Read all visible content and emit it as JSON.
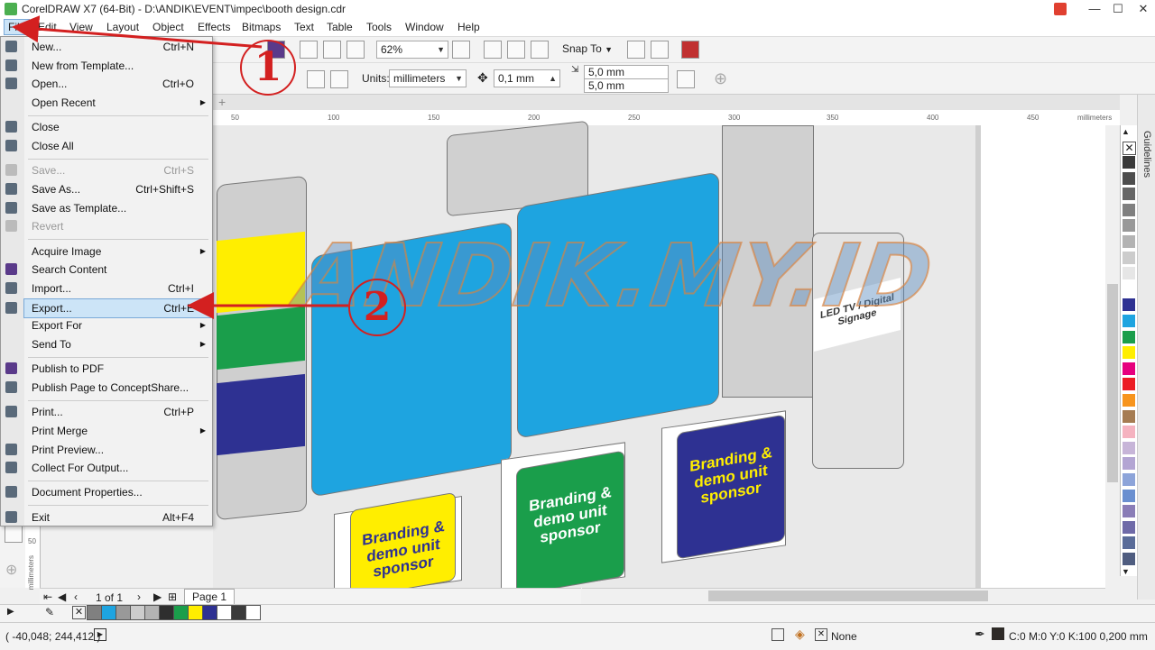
{
  "window": {
    "title": "CorelDRAW X7 (64-Bit) - D:\\ANDIK\\EVENT\\impec\\booth design.cdr",
    "min_icon": "minimize-icon",
    "max_icon": "maximize-icon",
    "close_glyph": "✕",
    "min_glyph": "—",
    "max_glyph": "☐"
  },
  "menubar": [
    "File",
    "Edit",
    "View",
    "Layout",
    "Object",
    "Effects",
    "Bitmaps",
    "Text",
    "Table",
    "Tools",
    "Window",
    "Help"
  ],
  "toolbar": {
    "zoom": "62%",
    "snap_to": "Snap To",
    "units_label": "Units:",
    "units_value": "millimeters",
    "nudge": "0,1 mm",
    "dup_x": "5,0 mm",
    "dup_y": "5,0 mm"
  },
  "ruler": {
    "ticks": [
      "50",
      "100",
      "150",
      "200",
      "250",
      "300",
      "350",
      "400",
      "450"
    ],
    "unit": "millimeters",
    "v_tick": "50",
    "v_unit": "millimeters"
  },
  "file_menu": [
    {
      "label": "New...",
      "shortcut": "Ctrl+N",
      "icon": "new-doc-icon"
    },
    {
      "label": "New from Template...",
      "shortcut": "",
      "icon": "template-icon"
    },
    {
      "label": "Open...",
      "shortcut": "Ctrl+O",
      "icon": "open-folder-icon"
    },
    {
      "label": "Open Recent",
      "shortcut": "",
      "submenu": true
    },
    {
      "label": "Close",
      "shortcut": "",
      "icon": "close-doc-icon"
    },
    {
      "label": "Close All",
      "shortcut": "",
      "icon": "close-all-icon"
    },
    {
      "label": "Save...",
      "shortcut": "Ctrl+S",
      "disabled": true,
      "icon": "save-icon"
    },
    {
      "label": "Save As...",
      "shortcut": "Ctrl+Shift+S",
      "icon": "save-as-icon"
    },
    {
      "label": "Save as Template...",
      "shortcut": "",
      "icon": "save-template-icon"
    },
    {
      "label": "Revert",
      "shortcut": "",
      "disabled": true,
      "icon": "revert-icon"
    },
    {
      "label": "Acquire Image",
      "shortcut": "",
      "submenu": true
    },
    {
      "label": "Search Content",
      "shortcut": "",
      "icon": "search-content-icon"
    },
    {
      "label": "Import...",
      "shortcut": "Ctrl+I",
      "icon": "import-icon"
    },
    {
      "label": "Export...",
      "shortcut": "Ctrl+E",
      "icon": "export-icon",
      "highlight": true
    },
    {
      "label": "Export For",
      "shortcut": "",
      "submenu": true
    },
    {
      "label": "Send To",
      "shortcut": "",
      "submenu": true
    },
    {
      "label": "Publish to PDF",
      "shortcut": "",
      "icon": "pdf-icon"
    },
    {
      "label": "Publish Page to ConceptShare...",
      "shortcut": "",
      "icon": "conceptshare-icon"
    },
    {
      "label": "Print...",
      "shortcut": "Ctrl+P",
      "icon": "print-icon"
    },
    {
      "label": "Print Merge",
      "shortcut": "",
      "submenu": true
    },
    {
      "label": "Print Preview...",
      "shortcut": "",
      "icon": "print-preview-icon"
    },
    {
      "label": "Collect For Output...",
      "shortcut": "",
      "icon": "collect-icon"
    },
    {
      "label": "Document Properties...",
      "shortcut": "",
      "icon": "doc-properties-icon"
    },
    {
      "label": "Exit",
      "shortcut": "Alt+F4",
      "icon": "exit-icon"
    }
  ],
  "canvas": {
    "sponsor_text": "Branding & demo unit sponsor",
    "led_text": "LED TV / Digital Signage",
    "watermark": "ANDIK.MY.ID"
  },
  "annotations": {
    "step1": "1",
    "step2": "2"
  },
  "page_nav": {
    "count": "1 of 1",
    "tab": "Page 1"
  },
  "status": {
    "coords": "( -40,048; 244,412 )",
    "fill": "None",
    "outline": "C:0 M:0 Y:0 K:100  0,200 mm"
  },
  "colors": {
    "cyan": "#1ea4e0",
    "yellow": "#ffee00",
    "green": "#1a9e4b",
    "navy": "#2e3192",
    "gray": "#cfcfcf",
    "annotation_red": "#d32020",
    "menu_highlight": "#cce4f7",
    "palette": [
      "#3a3a3a",
      "#4d4d4d",
      "#666666",
      "#808080",
      "#999999",
      "#b3b3b3",
      "#cccccc",
      "#e6e6e6",
      "#ffffff",
      "#2e3192",
      "#1ea4e0",
      "#1a9e4b",
      "#ffee00",
      "#e6007e",
      "#ec1c24",
      "#f7941d",
      "#a67c52",
      "#f5b3c0",
      "#c7b5d8",
      "#b3a5d3",
      "#8da4d9",
      "#6a8fd0",
      "#8a7db7",
      "#6f6aa8",
      "#5a6c99",
      "#4f5d80"
    ],
    "doc_palette": [
      "#808080",
      "#1ea4e0",
      "#999999",
      "#cccccc",
      "#b3b3b3",
      "#2e2e2e",
      "#1a9e4b",
      "#ffee00",
      "#2e3192",
      "#ffffff",
      "#3a3a3a",
      "#ffffff"
    ]
  }
}
